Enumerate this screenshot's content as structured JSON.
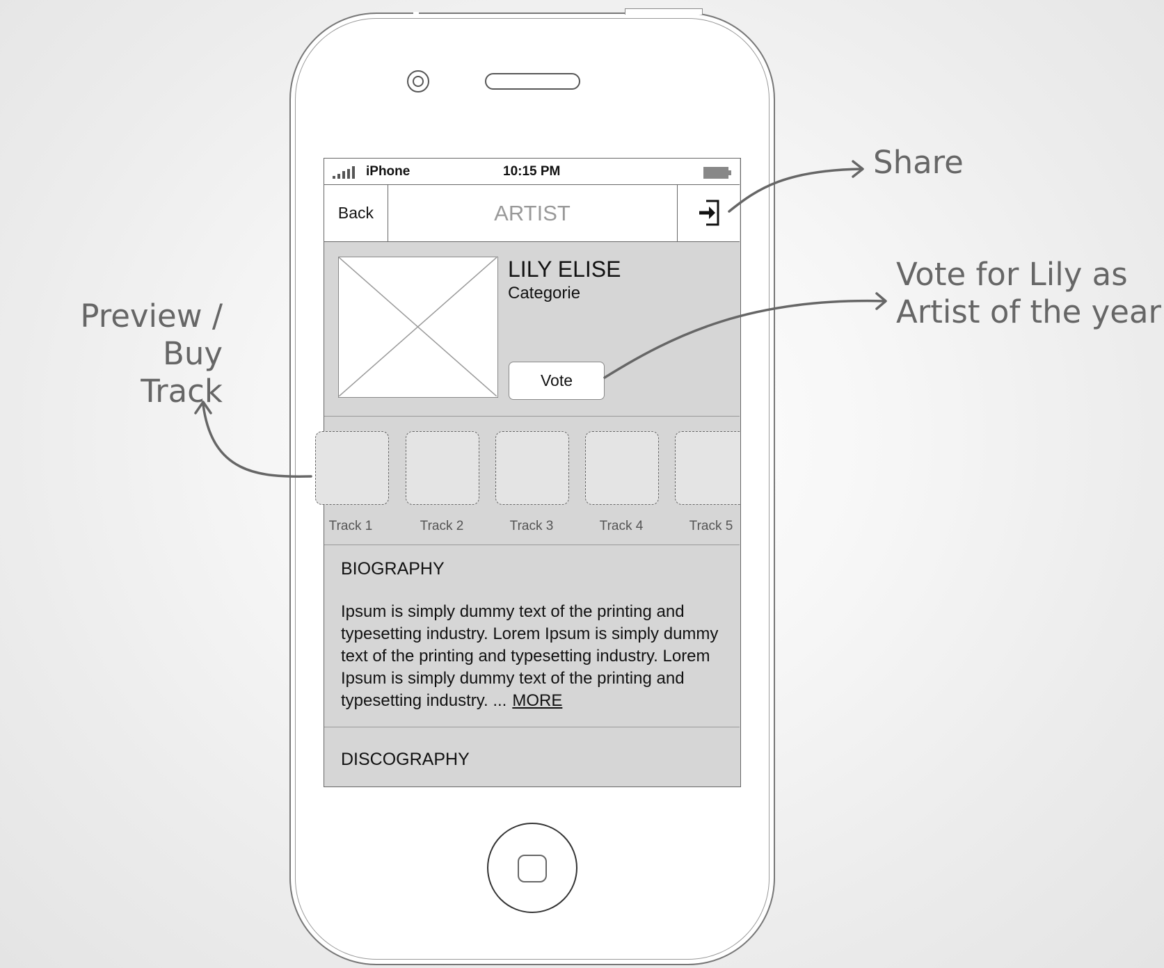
{
  "status_bar": {
    "carrier": "iPhone",
    "time": "10:15 PM"
  },
  "nav": {
    "back_label": "Back",
    "title": "ARTIST",
    "share_icon": "share-login-icon"
  },
  "artist": {
    "name": "LILY ELISE",
    "category": "Categorie",
    "vote_label": "Vote"
  },
  "tracks": [
    {
      "label": "Track 1"
    },
    {
      "label": "Track 2"
    },
    {
      "label": "Track 3"
    },
    {
      "label": "Track 4"
    },
    {
      "label": "Track 5"
    }
  ],
  "biography": {
    "title": "BIOGRAPHY",
    "text": "Ipsum is simply dummy text of the printing and typesetting industry. Lorem Ipsum is simply dummy text of the printing and typesetting industry. Lorem Ipsum is simply dummy text of the printing and typesetting industry. ...",
    "more_label": "MORE"
  },
  "discography": {
    "title": "DISCOGRAPHY"
  },
  "annotations": {
    "share": "Share",
    "vote_line1": "Vote for Lily as",
    "vote_line2": "Artist of the year",
    "preview_line1": "Preview / Buy",
    "preview_line2": "Track"
  },
  "colors": {
    "screen_background": "#d6d6d6",
    "annotation_text": "#666666",
    "arrow": "#666666"
  }
}
